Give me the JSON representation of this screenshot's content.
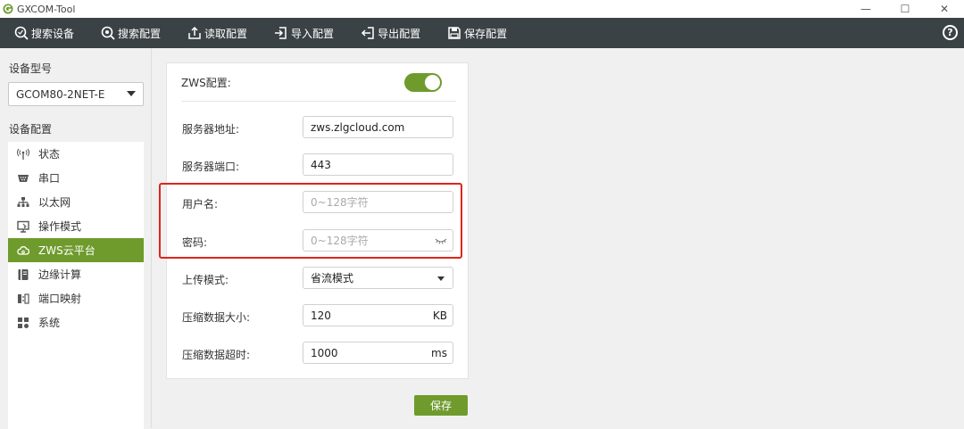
{
  "window": {
    "title": "GXCOM-Tool",
    "controls": [
      "—",
      "☐",
      "✕"
    ]
  },
  "toolbar": {
    "items": [
      {
        "label": "搜索设备",
        "icon": "search-device-icon"
      },
      {
        "label": "搜索配置",
        "icon": "search-config-icon"
      },
      {
        "label": "读取配置",
        "icon": "read-config-icon"
      },
      {
        "label": "导入配置",
        "icon": "import-config-icon"
      },
      {
        "label": "导出配置",
        "icon": "export-config-icon"
      },
      {
        "label": "保存配置",
        "icon": "save-config-icon"
      }
    ],
    "help": "?"
  },
  "sidebar": {
    "model_label": "设备型号",
    "model_value": "GCOM80-2NET-E",
    "config_label": "设备配置",
    "items": [
      {
        "label": "状态",
        "icon": "signal-icon"
      },
      {
        "label": "串口",
        "icon": "serial-port-icon"
      },
      {
        "label": "以太网",
        "icon": "ethernet-icon"
      },
      {
        "label": "操作模式",
        "icon": "monitor-icon"
      },
      {
        "label": "ZWS云平台",
        "icon": "cloud-icon",
        "active": true
      },
      {
        "label": "边缘计算",
        "icon": "book-icon"
      },
      {
        "label": "端口映射",
        "icon": "port-map-icon"
      },
      {
        "label": "系统",
        "icon": "grid-icon"
      }
    ]
  },
  "form": {
    "zws_label": "ZWS配置:",
    "zws_enabled": true,
    "server_addr_label": "服务器地址:",
    "server_addr_value": "zws.zlgcloud.com",
    "server_port_label": "服务器端口:",
    "server_port_value": "443",
    "username_label": "用户名:",
    "username_placeholder": "0~128字符",
    "password_label": "密码:",
    "password_placeholder": "0~128字符",
    "upload_mode_label": "上传模式:",
    "upload_mode_value": "省流模式",
    "compress_size_label": "压缩数据大小:",
    "compress_size_value": "120",
    "compress_size_unit": "KB",
    "compress_timeout_label": "压缩数据超时:",
    "compress_timeout_value": "1000",
    "compress_timeout_unit": "ms",
    "save_label": "保存"
  },
  "colors": {
    "accent": "#6f9b2d",
    "toolbar": "#3b4246",
    "highlight": "#e0241c"
  }
}
